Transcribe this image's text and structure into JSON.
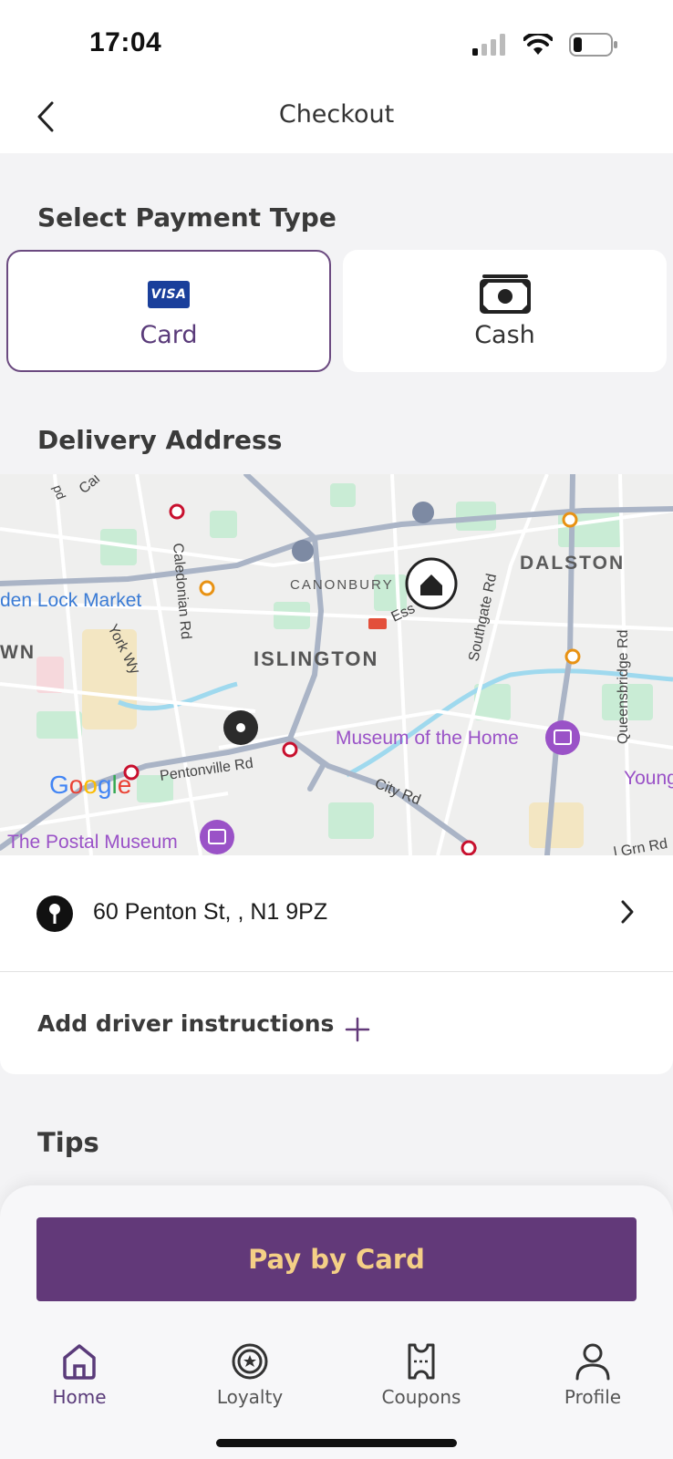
{
  "status_bar": {
    "time": "17:04"
  },
  "header": {
    "title": "Checkout"
  },
  "payment": {
    "section_title": "Select Payment Type",
    "options": [
      {
        "label": "Card",
        "badge": "VISA",
        "selected": true
      },
      {
        "label": "Cash",
        "selected": false
      }
    ]
  },
  "delivery": {
    "section_title": "Delivery Address",
    "map": {
      "labels": {
        "dalston": "DALSTON",
        "canonbury": "CANONBURY",
        "islington": "ISLINGTON",
        "lock_market": "den Lock Market",
        "own": "WN",
        "caledonian": "Caledonian Rd",
        "york_wy": "York Wy",
        "southgate": "Southgate Rd",
        "queensbridge": "Queensbridge Rd",
        "pentonville": "Pentonville Rd",
        "city_rd": "City Rd",
        "museum_home": "Museum of the Home",
        "postal_museum": "The Postal Museum",
        "young": "Young",
        "ess": "Ess",
        "grn": "l Grn Rd",
        "cai": "Cai",
        "pd": "pd"
      },
      "google": [
        "G",
        "o",
        "o",
        "g",
        "l",
        "e"
      ],
      "google_colors": [
        "#4285F4",
        "#EA4335",
        "#FBBC05",
        "#4285F4",
        "#34A853",
        "#EA4335"
      ]
    },
    "address": "60 Penton St, , N1 9PZ",
    "driver_instructions": "Add driver instructions"
  },
  "tips": {
    "section_title": "Tips"
  },
  "pay_button": {
    "label": "Pay by Card"
  },
  "tabs": [
    {
      "label": "Home",
      "icon": "home-icon",
      "active": true
    },
    {
      "label": "Loyalty",
      "icon": "loyalty-icon",
      "active": false
    },
    {
      "label": "Coupons",
      "icon": "coupon-icon",
      "active": false
    },
    {
      "label": "Profile",
      "icon": "profile-icon",
      "active": false
    }
  ],
  "colors": {
    "accent": "#623979",
    "button_text": "#f4cf86",
    "active_tab": "#5a3b7a"
  }
}
